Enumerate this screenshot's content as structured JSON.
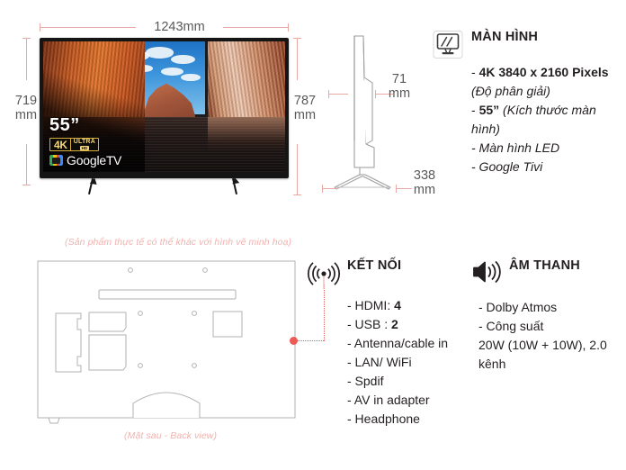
{
  "dimensions": {
    "width_top": "1243mm",
    "height_left": "719\nmm",
    "height_right": "787\nmm",
    "depth_side": "71\nmm",
    "stand_depth": "338\nmm"
  },
  "tv_front": {
    "size_label": "55”",
    "badge_4k": {
      "k": "4K",
      "ultra": "ULTRA",
      "hd": "HD"
    },
    "google_tv": {
      "google": "Google",
      "tv": "TV",
      "mark": "google-tv-mark"
    }
  },
  "captions": {
    "disclaimer": "(Sản phẩm thực tế có thể khác với hình vẽ minh hoạ)",
    "back_view": "(Mặt sau - Back view)"
  },
  "specs": {
    "display": {
      "icon": "monitor-icon",
      "title": "MÀN HÌNH",
      "items": [
        {
          "prefix": "- ",
          "bold": "4K 3840 x 2160 Pixels",
          "italic": " (Độ phân giải)"
        },
        {
          "prefix": "- ",
          "bold": "55”",
          "italic": " (Kích thước màn hình)"
        },
        {
          "prefix": "",
          "bold": "",
          "italic": "- Màn hình LED"
        },
        {
          "prefix": "",
          "bold": "",
          "italic": "- Google Tivi"
        }
      ]
    },
    "connectivity": {
      "icon": "signal-waves-icon",
      "title": "KẾT NỐI",
      "items": [
        {
          "label": "- HDMI: ",
          "value": "4"
        },
        {
          "label": "- USB : ",
          "value": "2"
        },
        {
          "label": "- Antenna/cable in",
          "value": ""
        },
        {
          "label": "- LAN/ WiFi",
          "value": ""
        },
        {
          "label": "- Spdif",
          "value": ""
        },
        {
          "label": "- AV in adapter",
          "value": ""
        },
        {
          "label": "- Headphone",
          "value": ""
        }
      ]
    },
    "audio": {
      "icon": "speaker-icon",
      "title": "ÂM THANH",
      "items": [
        "- Dolby Atmos",
        "- Công suất",
        "20W (10W + 10W), 2.0",
        "kênh"
      ]
    }
  },
  "colors": {
    "dimension_line": "#e8a9a4",
    "caption_text": "#f0b2ae",
    "connector_dot": "#ec5b55",
    "body_text": "#231f20",
    "dimension_text": "#58595b"
  }
}
